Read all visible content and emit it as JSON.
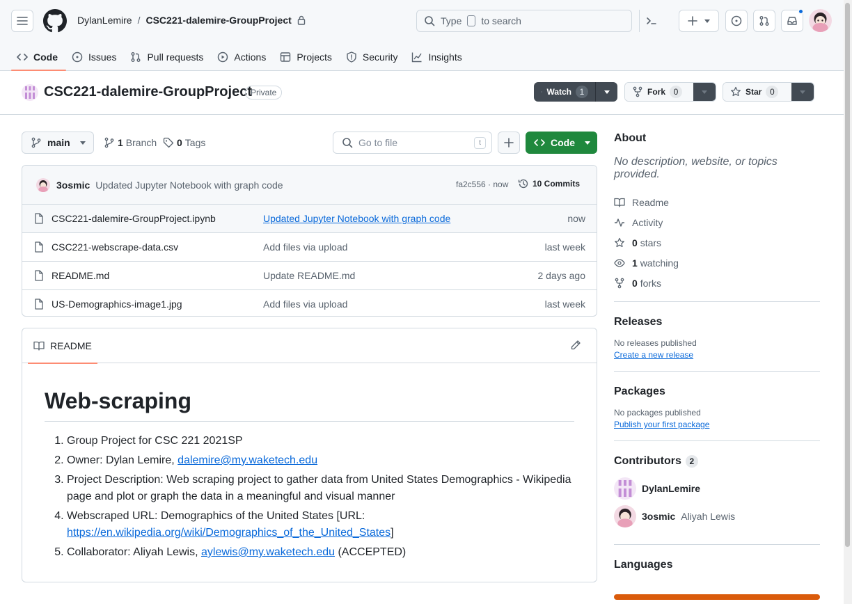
{
  "header": {
    "owner": "DylanLemire",
    "separator": "/",
    "repo": "CSC221-dalemire-GroupProject",
    "search_prefix": "Type",
    "search_suffix": "to search"
  },
  "tabs": [
    {
      "label": "Code",
      "icon": "code-icon"
    },
    {
      "label": "Issues",
      "icon": "issue-icon"
    },
    {
      "label": "Pull requests",
      "icon": "pull-request-icon"
    },
    {
      "label": "Actions",
      "icon": "play-icon"
    },
    {
      "label": "Projects",
      "icon": "table-icon"
    },
    {
      "label": "Security",
      "icon": "shield-icon"
    },
    {
      "label": "Insights",
      "icon": "graph-icon"
    }
  ],
  "repo_header": {
    "name": "CSC221-dalemire-GroupProject",
    "visibility": "Private",
    "watch_label": "Watch",
    "watch_count": "1",
    "fork_label": "Fork",
    "fork_count": "0",
    "star_label": "Star",
    "star_count": "0"
  },
  "toolbar": {
    "branch": "main",
    "branches_count": "1",
    "branches_label": "Branch",
    "tags_count": "0",
    "tags_label": "Tags",
    "go_to_file_placeholder": "Go to file",
    "go_to_file_key": "t",
    "code_label": "Code"
  },
  "latest_commit": {
    "author": "3osmic",
    "message": "Updated Jupyter Notebook with graph code",
    "sha_time": "fa2c556 · now",
    "commits_label": "10 Commits"
  },
  "files": [
    {
      "name": "CSC221-dalemire-GroupProject.ipynb",
      "message": "Updated Jupyter Notebook with graph code",
      "date": "now"
    },
    {
      "name": "CSC221-webscrape-data.csv",
      "message": "Add files via upload",
      "date": "last week"
    },
    {
      "name": "README.md",
      "message": "Update README.md",
      "date": "2 days ago"
    },
    {
      "name": "US-Demographics-image1.jpg",
      "message": "Add files via upload",
      "date": "last week"
    }
  ],
  "readme": {
    "tab_label": "README",
    "title": "Web-scraping",
    "item1": "Group Project for CSC 221 2021SP",
    "item2_prefix": "Owner: Dylan Lemire, ",
    "item2_email": "dalemire@my.waketech.edu",
    "item3": "Project Description: Web scraping project to gather data from United States Demographics - Wikipedia page and plot or graph the data in a meaningful and visual manner",
    "item4_prefix": "Webscraped URL: Demographics of the United States [URL: ",
    "item4_url": "https://en.wikipedia.org/wiki/Demographics_of_the_United_States",
    "item4_suffix": "]",
    "item5_prefix": "Collaborator: Aliyah Lewis, ",
    "item5_email": "aylewis@my.waketech.edu",
    "item5_suffix": "(ACCEPTED)"
  },
  "sidebar": {
    "about_title": "About",
    "about_desc": "No description, website, or topics provided.",
    "readme_label": "Readme",
    "activity_label": "Activity",
    "stars_count": "0",
    "stars_label": "stars",
    "watching_count": "1",
    "watching_label": "watching",
    "forks_count": "0",
    "forks_label": "forks",
    "releases_title": "Releases",
    "releases_none": "No releases published",
    "releases_link": "Create a new release",
    "packages_title": "Packages",
    "packages_none": "No packages published",
    "packages_link": "Publish your first package",
    "contributors_title": "Contributors",
    "contributors_count": "2",
    "contributors": [
      {
        "login": "DylanLemire",
        "name": ""
      },
      {
        "login": "3osmic",
        "name": "Aliyah Lewis"
      }
    ],
    "languages_title": "Languages"
  },
  "colors": {
    "accent_tab_underline": "#fd8c73",
    "code_button": "#1f883d",
    "link": "#0969da",
    "language_bar": "#da5b0b"
  }
}
